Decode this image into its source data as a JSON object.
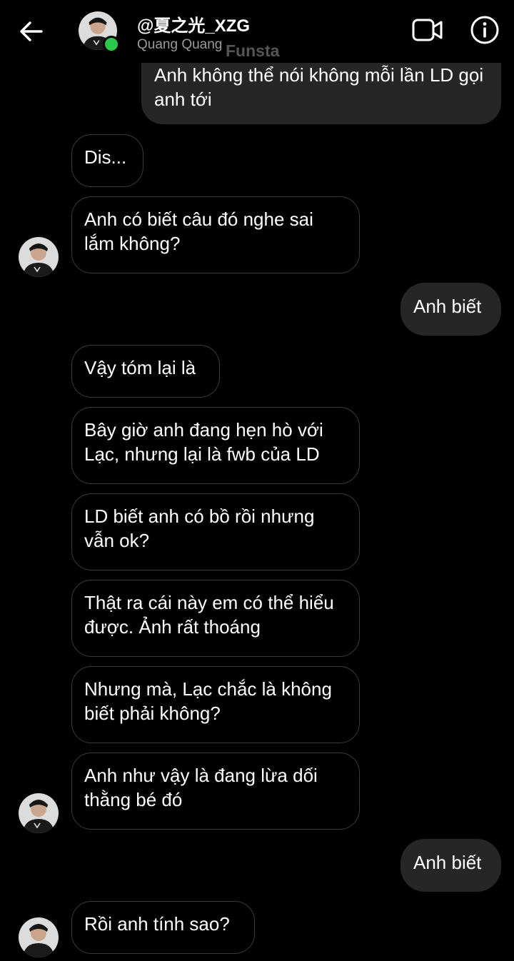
{
  "header": {
    "title": "@夏之光_XZG",
    "subtitle": "Quang Quang",
    "watermark": "Funsta",
    "back_icon": "arrow-left-icon",
    "video_icon": "video-call-icon",
    "info_icon": "info-icon",
    "online_color": "#2cc84d"
  },
  "messages": [
    {
      "from": "me",
      "text": "Anh không thể nói không mỗi lần LD gọi anh tới"
    },
    {
      "from": "them",
      "text": "Dis..."
    },
    {
      "from": "them",
      "text": "Anh có biết câu đó nghe sai lắm không?"
    },
    {
      "from": "me",
      "text": "Anh biết"
    },
    {
      "from": "them",
      "text": "Vậy tóm lại là"
    },
    {
      "from": "them",
      "text": "Bây giờ anh đang hẹn hò với Lạc, nhưng lại là fwb của LD"
    },
    {
      "from": "them",
      "text": "LD biết anh có bồ rồi nhưng vẫn ok?"
    },
    {
      "from": "them",
      "text": "Thật ra cái này em có thể hiểu được. Ảnh rất thoáng"
    },
    {
      "from": "them",
      "text": "Nhưng mà, Lạc chắc là không biết phải không?"
    },
    {
      "from": "them",
      "text": "Anh như vậy là đang lừa dối thằng bé đó"
    },
    {
      "from": "me",
      "text": "Anh biết"
    },
    {
      "from": "them",
      "text": "Rồi anh tính sao?"
    }
  ],
  "colors": {
    "background": "#000000",
    "outgoing_bubble": "#262626",
    "incoming_border": "#3b3b3b"
  }
}
